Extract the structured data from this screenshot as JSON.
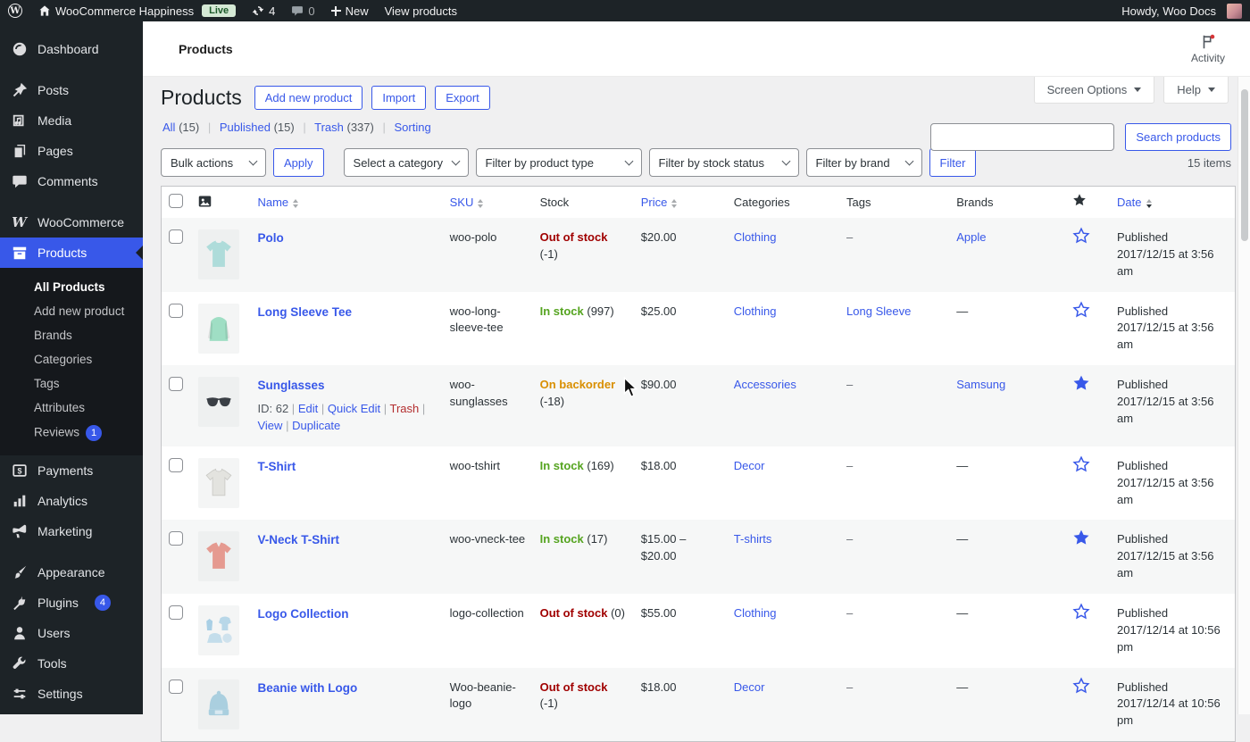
{
  "misc": {
    "sep": "|",
    "accent": "#3858e9"
  },
  "admin_bar": {
    "site_name": "WooCommerce Happiness",
    "live_badge": "Live",
    "updates_count": "4",
    "comments_count": "0",
    "new_label": "New",
    "view_products": "View products",
    "howdy": "Howdy, Woo Docs"
  },
  "sidebar": {
    "dashboard": "Dashboard",
    "posts": "Posts",
    "media": "Media",
    "pages": "Pages",
    "comments": "Comments",
    "woocommerce": "WooCommerce",
    "products": "Products",
    "submenu": {
      "all_products": "All Products",
      "add_new": "Add new product",
      "brands": "Brands",
      "categories": "Categories",
      "tags": "Tags",
      "attributes": "Attributes",
      "reviews": "Reviews",
      "reviews_badge": "1"
    },
    "payments": "Payments",
    "analytics": "Analytics",
    "marketing": "Marketing",
    "appearance": "Appearance",
    "plugins": "Plugins",
    "plugins_badge": "4",
    "users": "Users",
    "tools": "Tools",
    "settings": "Settings"
  },
  "topbar": {
    "breadcrumb": "Products",
    "activity": "Activity"
  },
  "tabs": {
    "screen_options": "Screen Options",
    "help": "Help"
  },
  "page": {
    "title": "Products",
    "add_new": "Add new product",
    "import": "Import",
    "export": "Export",
    "views": [
      {
        "label": "All",
        "count": "(15)"
      },
      {
        "label": "Published",
        "count": "(15)"
      },
      {
        "label": "Trash",
        "count": "(337)"
      },
      {
        "label": "Sorting",
        "count": ""
      }
    ],
    "search_button": "Search products",
    "items_count": "15 items"
  },
  "filters": {
    "bulk_actions": "Bulk actions",
    "apply": "Apply",
    "category": "Select a category",
    "product_type": "Filter by product type",
    "stock_status": "Filter by stock status",
    "brand": "Filter by brand",
    "filter_button": "Filter"
  },
  "table": {
    "headers": {
      "name": "Name",
      "sku": "SKU",
      "stock": "Stock",
      "price": "Price",
      "categories": "Categories",
      "tags": "Tags",
      "brands": "Brands",
      "date": "Date"
    },
    "rows": [
      {
        "name": "Polo",
        "sku": "woo-polo",
        "stock_label": "Out of stock",
        "stock_count": "(-1)",
        "price": "$20.00",
        "category": "Clothing",
        "tags": "–",
        "brand": "Apple",
        "date": "Published 2017/12/15 at 3:56 am",
        "thumb_color": "#aedcda"
      },
      {
        "name": "Long Sleeve Tee",
        "sku": "woo-long-sleeve-tee",
        "stock_label": "In stock",
        "stock_count": "(997)",
        "price": "$25.00",
        "category": "Clothing",
        "tags": "Long Sleeve",
        "brand": "—",
        "date": "Published 2017/12/15 at 3:56 am",
        "thumb_color": "#9fdec4"
      },
      {
        "name": "Sunglasses",
        "sku": "woo-sunglasses",
        "stock_label": "On backorder",
        "stock_count": "(-18)",
        "price": "$90.00",
        "category": "Accessories",
        "tags": "–",
        "brand": "Samsung",
        "date": "Published 2017/12/15 at 3:56 am",
        "thumb_color": "#3a3f45",
        "actions": {
          "id": "ID: 62",
          "edit": "Edit",
          "quick_edit": "Quick Edit",
          "trash": "Trash",
          "view": "View",
          "duplicate": "Duplicate"
        }
      },
      {
        "name": "T-Shirt",
        "sku": "woo-tshirt",
        "stock_label": "In stock",
        "stock_count": "(169)",
        "price": "$18.00",
        "category": "Decor",
        "tags": "–",
        "brand": "—",
        "date": "Published 2017/12/15 at 3:56 am",
        "thumb_color": "#e3e3df"
      },
      {
        "name": "V-Neck T-Shirt",
        "sku": "woo-vneck-tee",
        "stock_label": "In stock",
        "stock_count": "(17)",
        "price": "$15.00 – $20.00",
        "category": "T-shirts",
        "tags": "–",
        "brand": "—",
        "date": "Published 2017/12/15 at 3:56 am",
        "thumb_color": "#e59a90"
      },
      {
        "name": "Logo Collection",
        "sku": "logo-collection",
        "stock_label": "Out of stock",
        "stock_count": "(0)",
        "price": "$55.00",
        "category": "Clothing",
        "tags": "–",
        "brand": "—",
        "date": "Published 2017/12/14 at 10:56 pm",
        "thumb_color": "#a9cfe5"
      },
      {
        "name": "Beanie with Logo",
        "sku": "Woo-beanie-logo",
        "stock_label": "Out of stock",
        "stock_count": "(-1)",
        "price": "$18.00",
        "category": "Decor",
        "tags": "–",
        "brand": "—",
        "date": "Published 2017/12/14 at 10:56 pm",
        "thumb_color": "#aacfdf"
      }
    ]
  }
}
